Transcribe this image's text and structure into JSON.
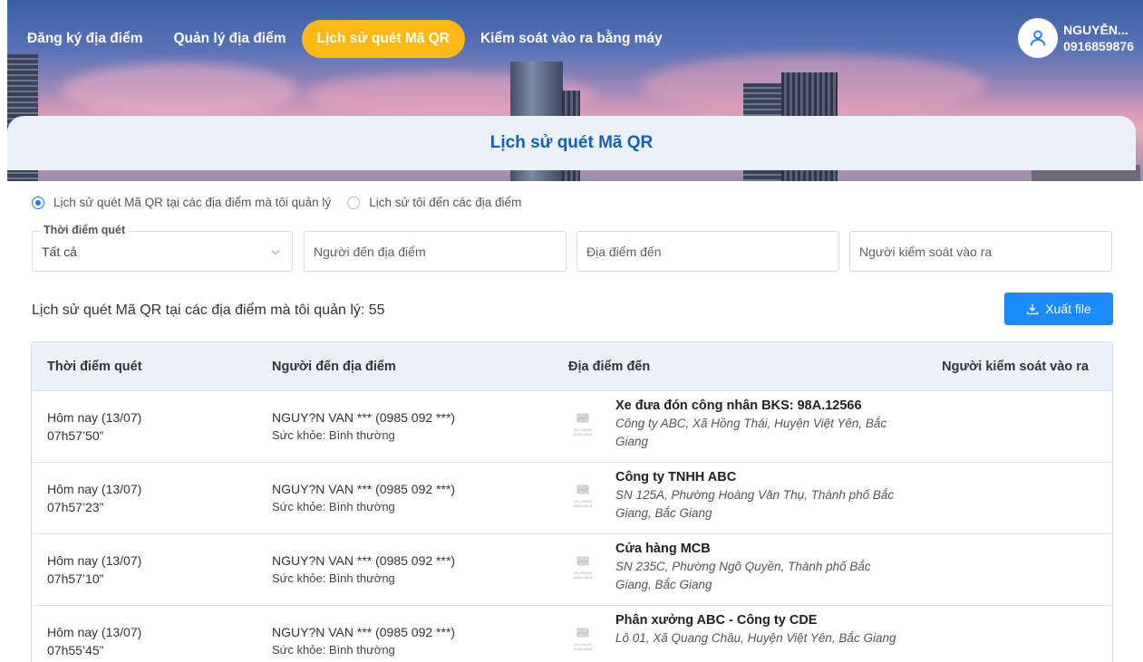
{
  "nav": {
    "items": [
      {
        "label": "Đăng ký địa điểm",
        "active": false
      },
      {
        "label": "Quản lý địa điểm",
        "active": false
      },
      {
        "label": "Lịch sử quét Mã QR",
        "active": true
      },
      {
        "label": "Kiểm soát vào ra bằng máy",
        "active": false
      }
    ],
    "user": {
      "name": "NGUYỄN...",
      "phone": "0916859876",
      "icon": "user-icon"
    }
  },
  "page": {
    "title": "Lịch sử quét Mã QR"
  },
  "filters": {
    "scope_options": [
      {
        "label": "Lịch sử quét Mã QR tại các địa điểm mà tôi quản lý",
        "checked": true
      },
      {
        "label": "Lịch sử tôi đến các địa điểm",
        "checked": false
      }
    ],
    "time": {
      "legend": "Thời điểm quét",
      "value": "Tất cả"
    },
    "visitor_placeholder": "Người đến địa điểm",
    "place_placeholder": "Địa điểm đến",
    "controller_placeholder": "Người kiểm soát vào ra"
  },
  "list": {
    "title": "Lịch sử quét Mã QR tại các địa điểm mà tôi quản lý: 55",
    "export_label": "Xuất file",
    "export_icon": "download-icon"
  },
  "table": {
    "columns": [
      "Thời điểm quét",
      "Người đến địa điểm",
      "Địa điểm đến",
      "Người kiểm soát vào ra"
    ],
    "no_image_text": "NO IMAGE AVAILABLE",
    "rows": [
      {
        "date": "Hôm nay (13/07)",
        "time": "07h57’50”",
        "person": "NGUY?N VAN *** (0985 092 ***)",
        "health": "Sức khỏe: Bình thường",
        "place": "Xe đưa đón công nhân BKS: 98A.12566",
        "address": "Công ty ABC, Xã Hồng Thái, Huyện Việt Yên, Bắc Giang",
        "controller": ""
      },
      {
        "date": "Hôm nay (13/07)",
        "time": "07h57’23”",
        "person": "NGUY?N VAN *** (0985 092 ***)",
        "health": "Sức khỏe: Bình thường",
        "place": "Công ty TNHH ABC",
        "address": "SN 125A, Phường Hoàng Văn Thụ, Thành phố Bắc Giang, Bắc Giang",
        "controller": ""
      },
      {
        "date": "Hôm nay (13/07)",
        "time": "07h57’10”",
        "person": "NGUY?N VAN *** (0985 092 ***)",
        "health": "Sức khỏe: Bình thường",
        "place": "Cửa hàng MCB",
        "address": "SN 235C, Phường Ngô Quyền, Thành phố Bắc Giang, Bắc Giang",
        "controller": ""
      },
      {
        "date": "Hôm nay (13/07)",
        "time": "07h55’45”",
        "person": "NGUY?N VAN *** (0985 092 ***)",
        "health": "Sức khỏe: Bình thường",
        "place": "Phân xưởng ABC - Công ty CDE",
        "address": "Lô 01, Xã Quang Châu, Huyện Việt Yên, Bắc Giang",
        "controller": ""
      }
    ]
  },
  "colors": {
    "active_nav": "#fdb813",
    "title_blue": "#1460b8",
    "button_blue": "#1a8cff",
    "header_bg": "#eaf1fa"
  }
}
